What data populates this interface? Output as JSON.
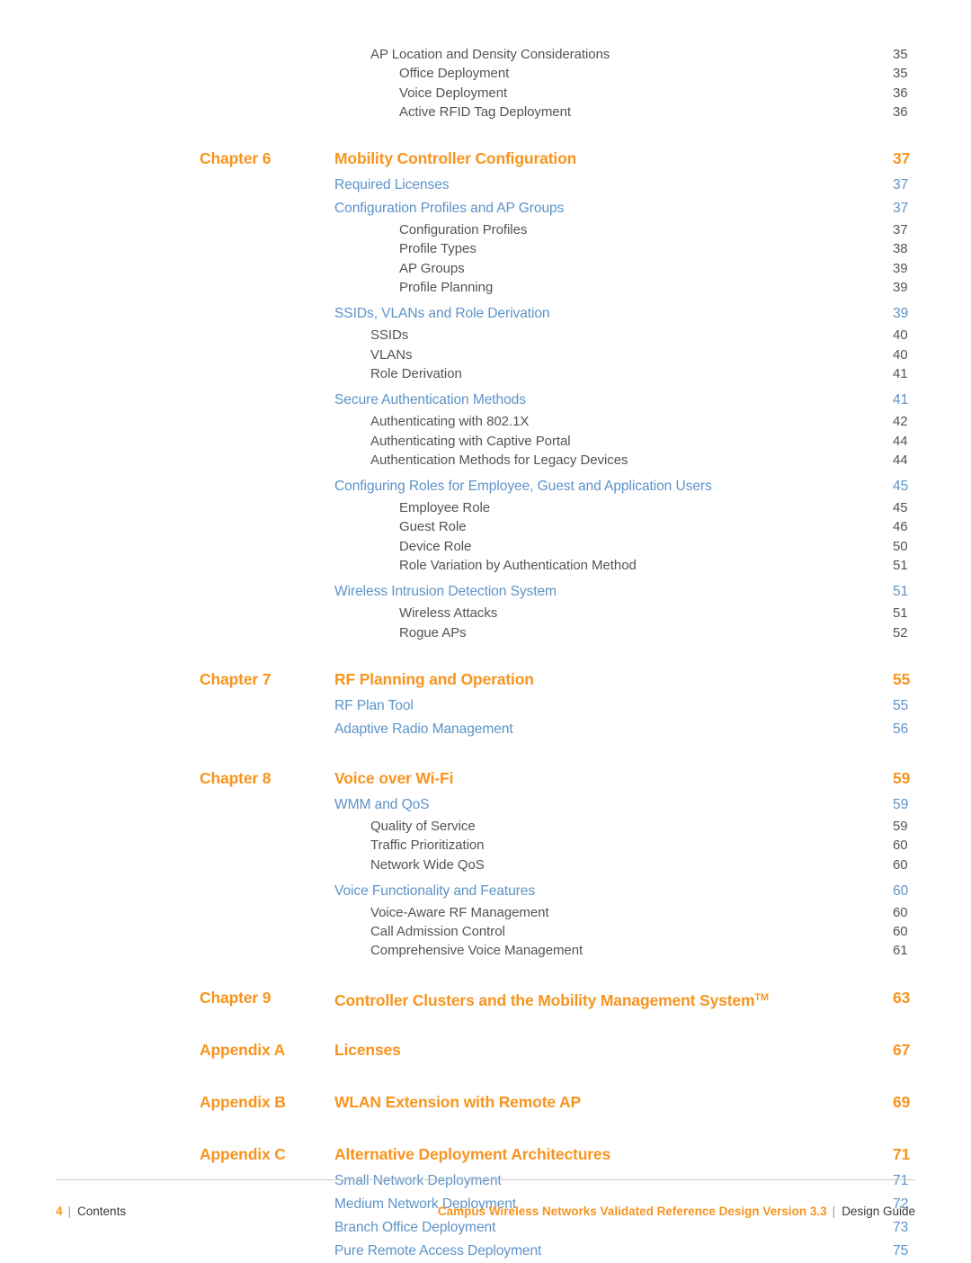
{
  "document": {
    "title": "Contents",
    "colors": {
      "accent_orange": "#F7941E",
      "section_blue": "#5D93C8",
      "body_gray": "#545454",
      "rule_gray": "#C9C9C9"
    }
  },
  "footer": {
    "page_number": "4",
    "separator": "|",
    "section_name": "Contents",
    "doc_title": "Campus Wireless Networks Validated Reference Design Version 3.3",
    "doc_type": "Design Guide"
  },
  "toc": {
    "entries": [
      {
        "level": 3,
        "label": "AP Location and Density Considerations",
        "page": "35"
      },
      {
        "level": 4,
        "label": "Office Deployment",
        "page": "35"
      },
      {
        "level": 4,
        "label": "Voice Deployment",
        "page": "36"
      },
      {
        "level": 4,
        "label": "Active RFID Tag Deployment",
        "page": "36"
      },
      {
        "level": 1,
        "chapter": "Chapter 6",
        "label": "Mobility Controller Configuration",
        "page": "37"
      },
      {
        "level": 2,
        "label": "Required Licenses",
        "page": "37"
      },
      {
        "level": 2,
        "label": "Configuration Profiles and AP Groups",
        "page": "37"
      },
      {
        "level": 4,
        "label": "Configuration Profiles",
        "page": "37"
      },
      {
        "level": 4,
        "label": "Profile Types",
        "page": "38"
      },
      {
        "level": 4,
        "label": "AP Groups",
        "page": "39"
      },
      {
        "level": 4,
        "label": "Profile Planning",
        "page": "39"
      },
      {
        "level": 2,
        "label": "SSIDs, VLANs and Role Derivation",
        "page": "39"
      },
      {
        "level": 3,
        "label": "SSIDs",
        "page": "40"
      },
      {
        "level": 3,
        "label": "VLANs",
        "page": "40"
      },
      {
        "level": 3,
        "label": "Role Derivation",
        "page": "41"
      },
      {
        "level": 2,
        "label": "Secure Authentication Methods",
        "page": "41"
      },
      {
        "level": 3,
        "label": "Authenticating with 802.1X",
        "page": "42"
      },
      {
        "level": 3,
        "label": "Authenticating with Captive Portal",
        "page": "44"
      },
      {
        "level": 3,
        "label": "Authentication Methods for Legacy Devices",
        "page": "44"
      },
      {
        "level": 2,
        "label": "Configuring Roles for Employee, Guest and Application Users",
        "page": "45"
      },
      {
        "level": 4,
        "label": "Employee Role",
        "page": "45"
      },
      {
        "level": 4,
        "label": "Guest Role",
        "page": "46"
      },
      {
        "level": 4,
        "label": "Device Role",
        "page": "50"
      },
      {
        "level": 4,
        "label": "Role Variation by Authentication Method",
        "page": "51"
      },
      {
        "level": 2,
        "label": "Wireless Intrusion Detection System",
        "page": "51"
      },
      {
        "level": 4,
        "label": "Wireless Attacks",
        "page": "51"
      },
      {
        "level": 4,
        "label": "Rogue APs",
        "page": "52"
      },
      {
        "level": 1,
        "chapter": "Chapter 7",
        "label": "RF Planning and Operation",
        "page": "55"
      },
      {
        "level": 2,
        "label": "RF Plan Tool",
        "page": "55"
      },
      {
        "level": 2,
        "label": "Adaptive Radio Management",
        "page": "56"
      },
      {
        "level": 1,
        "chapter": "Chapter 8",
        "label": "Voice over Wi-Fi",
        "page": "59"
      },
      {
        "level": 2,
        "label": "WMM and QoS",
        "page": "59"
      },
      {
        "level": 3,
        "label": "Quality of Service",
        "page": "59"
      },
      {
        "level": 3,
        "label": "Traffic Prioritization",
        "page": "60"
      },
      {
        "level": 3,
        "label": "Network Wide QoS",
        "page": "60"
      },
      {
        "level": 2,
        "label": "Voice Functionality and Features",
        "page": "60"
      },
      {
        "level": 3,
        "label": "Voice-Aware RF Management",
        "page": "60"
      },
      {
        "level": 3,
        "label": "Call Admission Control",
        "page": "60"
      },
      {
        "level": 3,
        "label": "Comprehensive Voice Management",
        "page": "61"
      },
      {
        "level": 1,
        "chapter": "Chapter 9",
        "label": "Controller Clusters and the Mobility Management System",
        "trademark": "TM",
        "page": "63"
      },
      {
        "level": 1,
        "chapter": "Appendix A",
        "label": "Licenses",
        "page": "67"
      },
      {
        "level": 1,
        "chapter": "Appendix B",
        "label": "WLAN Extension with Remote AP",
        "page": "69"
      },
      {
        "level": 1,
        "chapter": "Appendix C",
        "label": "Alternative Deployment Architectures",
        "page": "71"
      },
      {
        "level": 2,
        "label": "Small Network Deployment",
        "page": "71"
      },
      {
        "level": 2,
        "label": "Medium Network Deployment",
        "page": "72"
      },
      {
        "level": 2,
        "label": "Branch Office Deployment",
        "page": "73"
      },
      {
        "level": 2,
        "label": "Pure Remote Access Deployment",
        "page": "75"
      }
    ]
  }
}
